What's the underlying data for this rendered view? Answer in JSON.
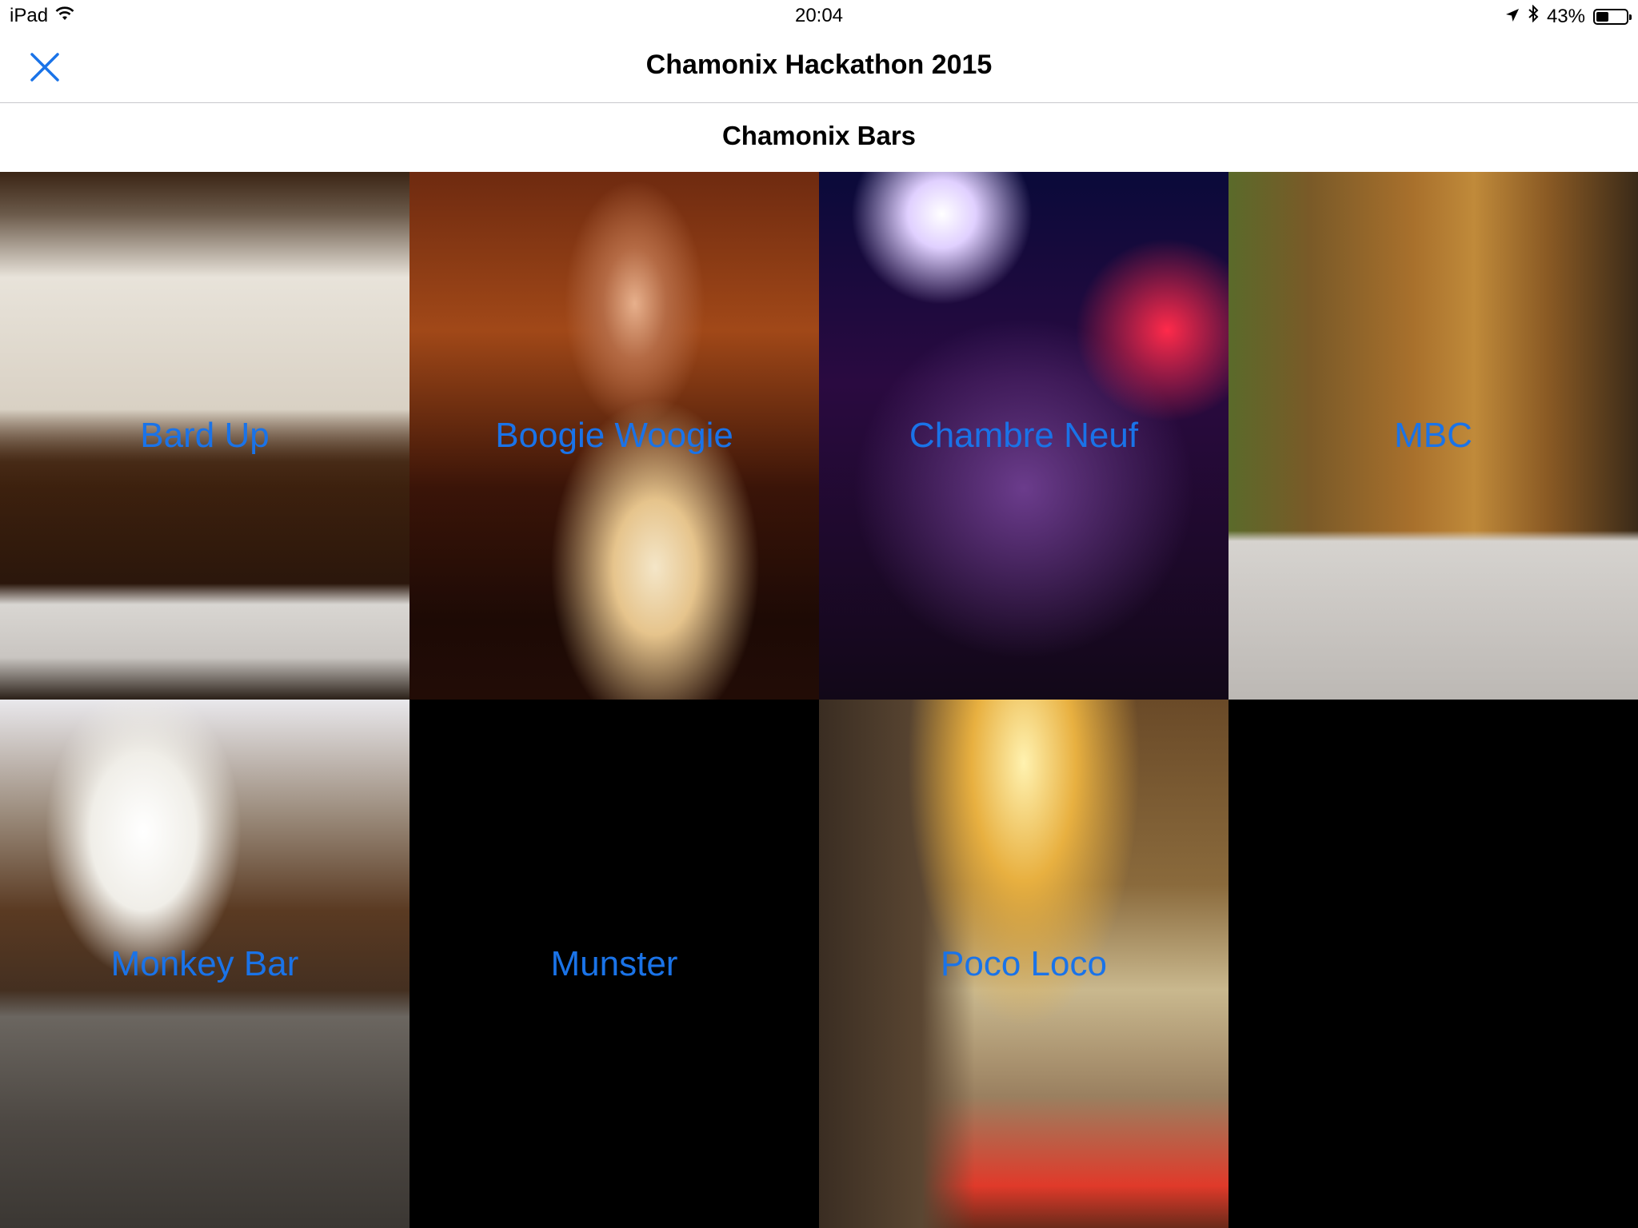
{
  "status_bar": {
    "device": "iPad",
    "time": "20:04",
    "battery": "43%",
    "battery_level": 0.43
  },
  "nav": {
    "title": "Chamonix Hackathon 2015",
    "close_icon": "close-icon"
  },
  "section": {
    "title": "Chamonix Bars"
  },
  "bars": [
    {
      "name": "Bard Up"
    },
    {
      "name": "Boogie Woogie"
    },
    {
      "name": "Chambre Neuf"
    },
    {
      "name": "MBC"
    },
    {
      "name": "Monkey Bar"
    },
    {
      "name": "Munster"
    },
    {
      "name": "Poco Loco"
    }
  ],
  "colors": {
    "accent": "#1a73e8",
    "background": "#000000"
  }
}
